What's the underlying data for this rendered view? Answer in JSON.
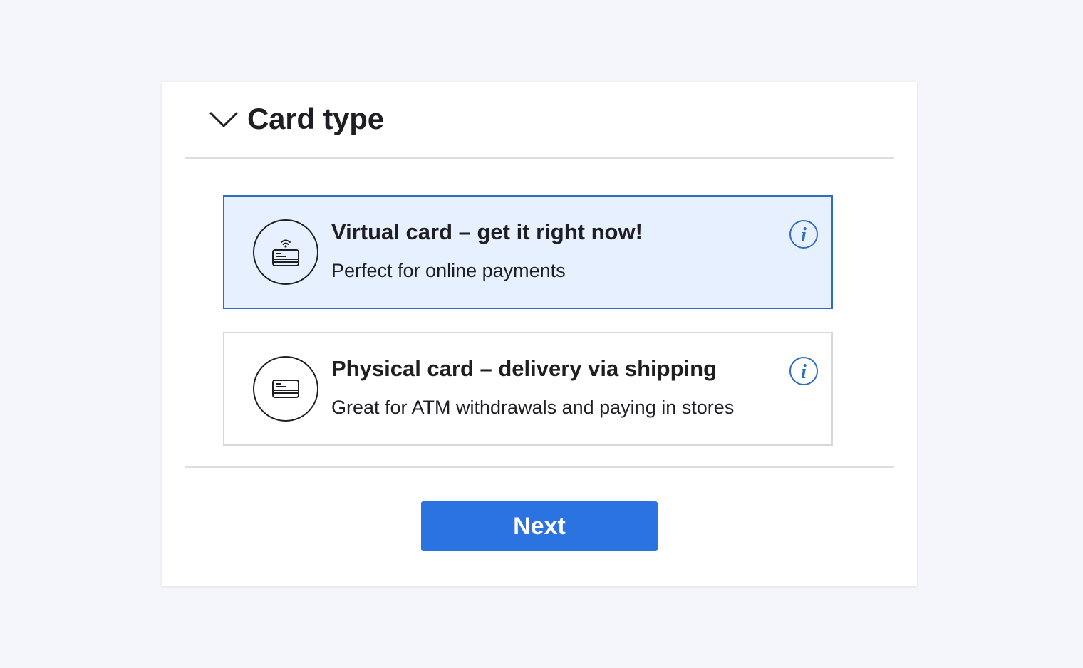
{
  "section": {
    "title": "Card type",
    "expanded": true
  },
  "options": [
    {
      "title": "Virtual card – get it right now!",
      "subtitle": "Perfect for online payments",
      "icon": "contactless-card-icon",
      "selected": true
    },
    {
      "title": "Physical card – delivery via shipping",
      "subtitle": "Great for ATM withdrawals and paying in stores",
      "icon": "credit-card-icon",
      "selected": false
    }
  ],
  "actions": {
    "next_label": "Next"
  },
  "colors": {
    "accent": "#2a73e0",
    "selected_border": "#2f6dc1",
    "selected_bg": "#e7f0fe",
    "info": "#2f6dc1",
    "page_bg": "#f5f6fb"
  }
}
